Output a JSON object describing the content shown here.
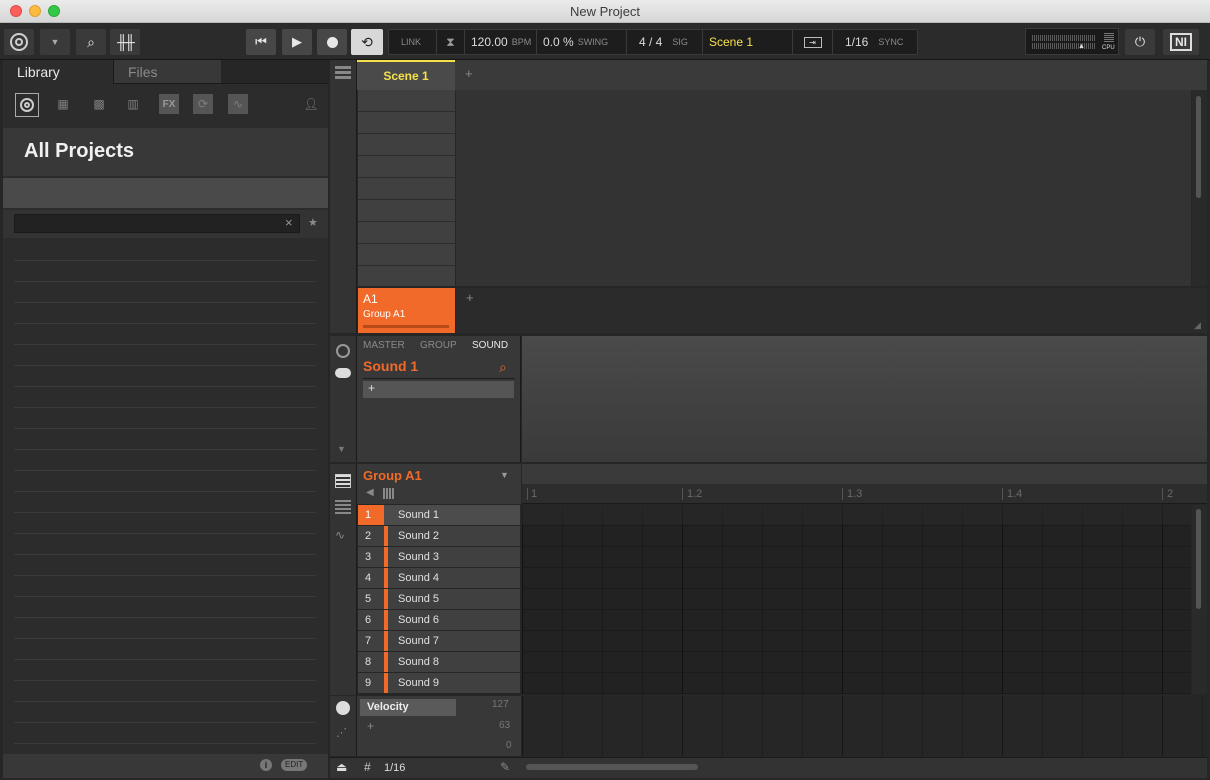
{
  "window": {
    "title": "New Project"
  },
  "toolbar": {
    "link": "LINK",
    "tempo": "120.00",
    "tempo_unit": "BPM",
    "swing": "0.0 %",
    "swing_label": "SWING",
    "signature": "4 / 4",
    "signature_label": "SIG",
    "scene": "Scene 1",
    "quantize": "1/16",
    "sync": "SYNC",
    "cpu_label": "CPU",
    "ni_logo": "NI"
  },
  "browser": {
    "tabs": [
      "Library",
      "Files"
    ],
    "active_tab": "Library",
    "filter_icons": [
      "maschine-icon",
      "groups-icon",
      "sounds-icon",
      "instruments-icon",
      "fx-icon",
      "loops-icon",
      "samples-icon",
      "user-icon"
    ],
    "fx_label": "FX",
    "heading": "All Projects",
    "search": {
      "value": "",
      "clear": "×",
      "star": "★"
    },
    "footer": {
      "info": "i",
      "edit": "EDIT"
    }
  },
  "arranger": {
    "scene_tab": "Scene 1",
    "add": "+",
    "group_tile": {
      "id": "A1",
      "name": "Group A1"
    }
  },
  "control": {
    "tabs": [
      "MASTER",
      "GROUP",
      "SOUND"
    ],
    "active_tab": "SOUND",
    "title": "Sound 1",
    "add": "+"
  },
  "pattern": {
    "group": "Group A1",
    "ruler": [
      "1",
      "1.2",
      "1.3",
      "1.4",
      "2"
    ],
    "sounds": [
      {
        "num": "1",
        "name": "Sound 1"
      },
      {
        "num": "2",
        "name": "Sound 2"
      },
      {
        "num": "3",
        "name": "Sound 3"
      },
      {
        "num": "4",
        "name": "Sound 4"
      },
      {
        "num": "5",
        "name": "Sound 5"
      },
      {
        "num": "6",
        "name": "Sound 6"
      },
      {
        "num": "7",
        "name": "Sound 7"
      },
      {
        "num": "8",
        "name": "Sound 8"
      },
      {
        "num": "9",
        "name": "Sound 9"
      }
    ],
    "active_sound": 1
  },
  "velocity": {
    "label": "Velocity",
    "max": "127",
    "mid": "63",
    "min": "0",
    "add": "+"
  },
  "footer": {
    "grid": "1/16"
  },
  "colors": {
    "accent_orange": "#f26a2a",
    "accent_yellow": "#f5e24a"
  }
}
